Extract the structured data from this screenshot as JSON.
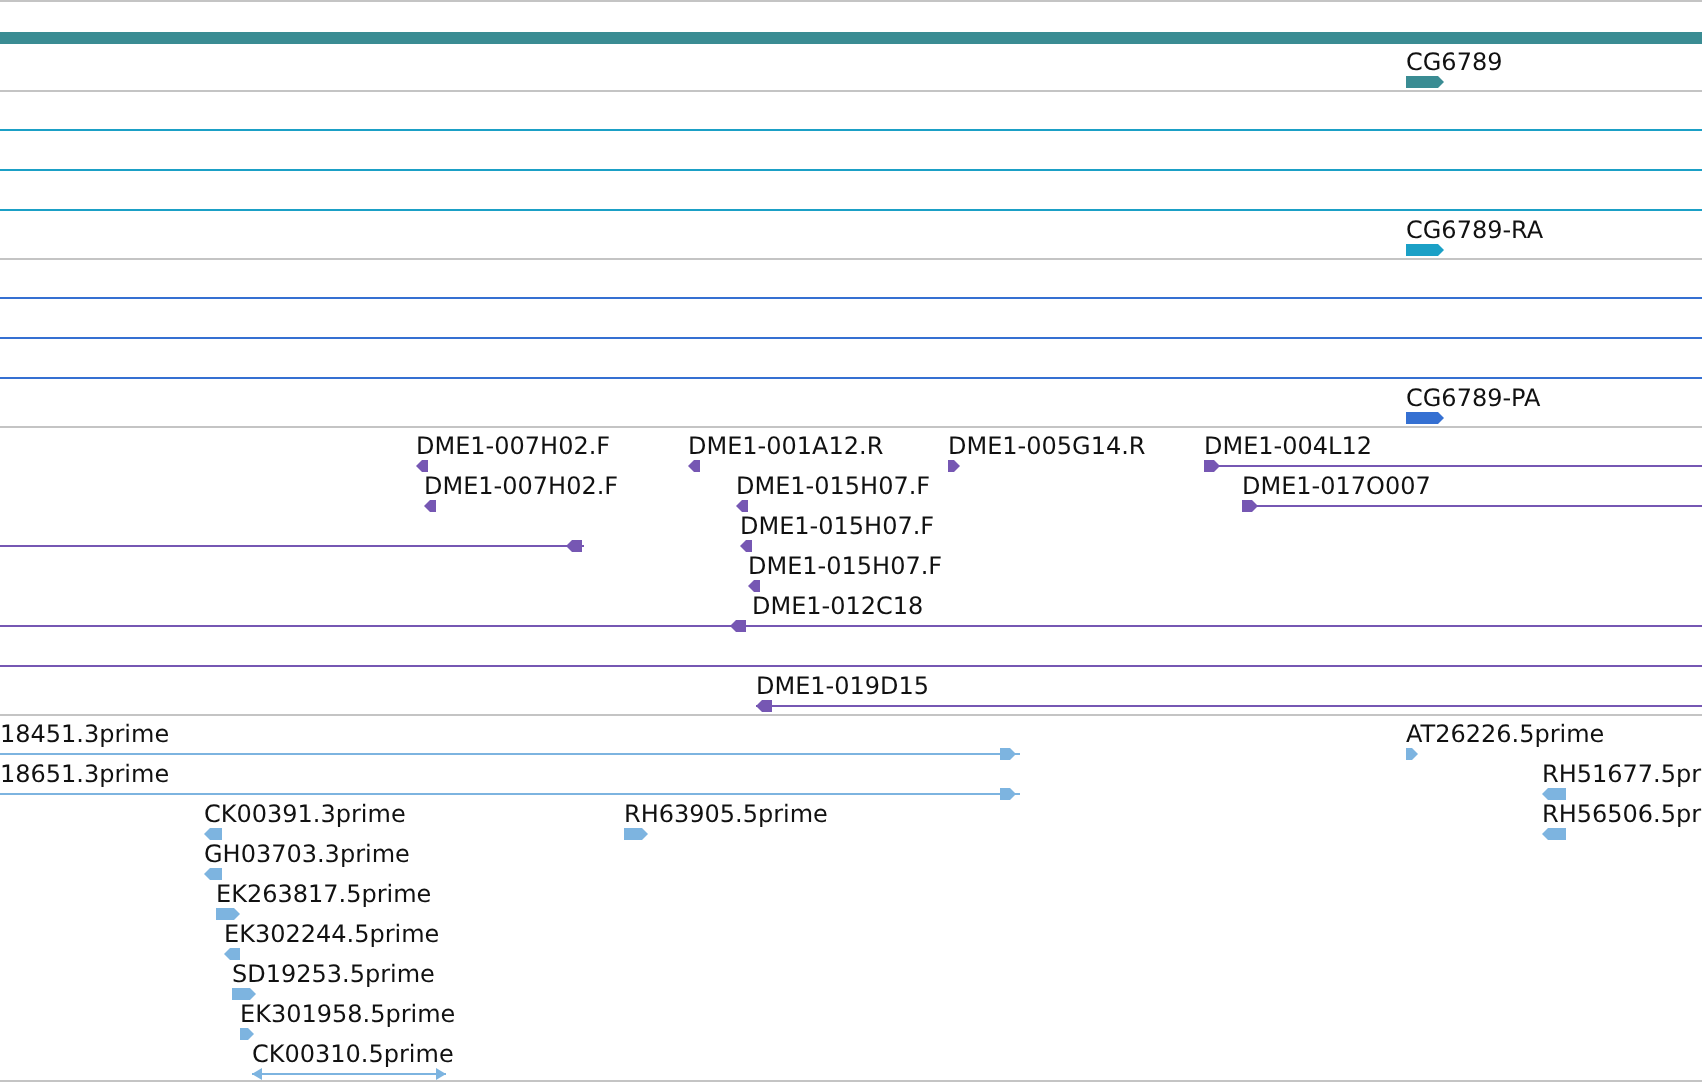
{
  "tracks": [
    {
      "color": "#3a8c93",
      "features": [
        {
          "kind": "bar"
        },
        {
          "kind": "feature",
          "label": "CG6789",
          "head_left": false,
          "head_right": true
        }
      ]
    },
    {
      "color": "#1ba0c6",
      "features": [
        {
          "kind": "line"
        },
        {
          "kind": "line"
        },
        {
          "kind": "line"
        },
        {
          "kind": "feature",
          "label": "CG6789-RA",
          "head_left": false,
          "head_right": true
        }
      ]
    },
    {
      "color": "#3570d2",
      "features": [
        {
          "kind": "line"
        },
        {
          "kind": "line"
        },
        {
          "kind": "line"
        },
        {
          "kind": "feature",
          "label": "CG6789-PA",
          "head_left": false,
          "head_right": true
        }
      ]
    },
    {
      "color": "#7657b3",
      "features": [
        {
          "kind": "feature",
          "label": "DME1-007H02.F",
          "head_left": true,
          "head_right": false
        },
        {
          "kind": "feature",
          "label": "DME1-001A12.R",
          "head_left": true,
          "head_right": false
        },
        {
          "kind": "feature",
          "label": "DME1-005G14.R",
          "head_left": false,
          "head_right": true
        },
        {
          "kind": "feature",
          "label": "DME1-004L12",
          "head_left": false,
          "head_right": true
        },
        {
          "kind": "feature",
          "label": "DME1-007H02.F",
          "head_left": true,
          "head_right": false
        },
        {
          "kind": "feature",
          "label": "DME1-015H07.F",
          "head_left": true,
          "head_right": false
        },
        {
          "kind": "feature",
          "label": "DME1-017O007",
          "head_left": false,
          "head_right": true
        },
        {
          "kind": "line",
          "head_left": true,
          "head_right": false
        },
        {
          "kind": "feature",
          "label": "DME1-015H07.F",
          "head_left": true,
          "head_right": false
        },
        {
          "kind": "feature",
          "label": "DME1-015H07.F",
          "head_left": true,
          "head_right": false
        },
        {
          "kind": "feature",
          "label": "DME1-012C18",
          "head_left": true,
          "head_right": false
        },
        {
          "kind": "line"
        },
        {
          "kind": "feature",
          "label": "DME1-019D15",
          "head_left": true,
          "head_right": false
        }
      ]
    },
    {
      "color": "#7db4e0",
      "features": [
        {
          "kind": "feature",
          "label": "18451.3prime",
          "head_left": false,
          "head_right": true
        },
        {
          "kind": "feature",
          "label": "AT26226.5prime",
          "head_left": false,
          "head_right": true
        },
        {
          "kind": "feature",
          "label": "18651.3prime",
          "head_left": false,
          "head_right": true
        },
        {
          "kind": "feature",
          "label": "RH51677.5pr",
          "head_left": true,
          "head_right": false
        },
        {
          "kind": "feature",
          "label": "CK00391.3prime",
          "head_left": true,
          "head_right": false
        },
        {
          "kind": "feature",
          "label": "RH63905.5prime",
          "head_left": false,
          "head_right": true
        },
        {
          "kind": "feature",
          "label": "RH56506.5pr",
          "head_left": true,
          "head_right": false
        },
        {
          "kind": "feature",
          "label": "GH03703.3prime",
          "head_left": true,
          "head_right": false
        },
        {
          "kind": "feature",
          "label": "EK263817.5prime",
          "head_left": false,
          "head_right": true
        },
        {
          "kind": "feature",
          "label": "EK302244.5prime",
          "head_left": true,
          "head_right": false
        },
        {
          "kind": "feature",
          "label": "SD19253.5prime",
          "head_left": false,
          "head_right": true
        },
        {
          "kind": "feature",
          "label": "EK301958.5prime",
          "head_left": false,
          "head_right": true
        },
        {
          "kind": "feature",
          "label": "CK00310.5prime",
          "head_left": true,
          "head_right": true
        }
      ]
    }
  ]
}
